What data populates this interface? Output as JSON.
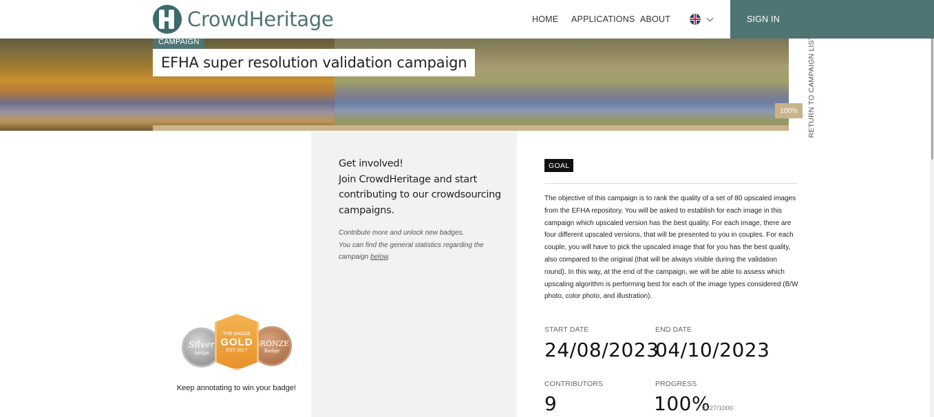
{
  "header": {
    "logo_text": "CrowdHeritage",
    "nav": {
      "home": "HOME",
      "applications": "APPLICATIONS",
      "about": "ABOUT"
    },
    "language_icon": "uk-flag-icon",
    "sign_in": "SIGN IN"
  },
  "hero": {
    "tag": "CAMPAIGN",
    "title": "EFHA super resolution validation campaign",
    "progress_percent": 100,
    "progress_label": "100%",
    "return_link": "RETURN TO CAMPAIGN LIST"
  },
  "badges": {
    "silver": {
      "label": "Silver",
      "sub": "badge"
    },
    "gold": {
      "label": "GOLD",
      "top": "THE BADGE",
      "sub": "EST 2017"
    },
    "bronze": {
      "label": "BRONZE",
      "sub": "Badge"
    },
    "caption": "Keep annotating to win your badge!"
  },
  "involve": {
    "line1": "Get involved!",
    "line2": "Join CrowdHeritage and start contributing to our crowdsourcing campaigns.",
    "note1": "Contribute more and unlock new badges.",
    "note2_prefix": "You can find the general statistics regarding the campaign ",
    "note2_link": "below",
    "note2_suffix": "."
  },
  "goal": {
    "tag": "GOAL",
    "description": "The objective of this campaign is to rank the quality of a set of 80 upscaled images from the EFHA repository. You will be asked to establish for each image in this campaign which upscaled version has the best quality. For each image, there are four different upscaled versions, that will be presented to you in couples. For each couple, you will have to pick the upscaled image that for you has the best quality, also compared to the original (that will be always visible during the validation round). In this way, at the end of the campaign, we will be able to assess which upscaling algorithm is performing best for each of the image types considered (B/W photo, color photo, and illustration)."
  },
  "stats": {
    "start_label": "START DATE",
    "start_value": "24/08/2023",
    "end_label": "END DATE",
    "end_value": "04/10/2023",
    "contributors_label": "CONTRIBUTORS",
    "contributors_value": "9",
    "progress_label": "PROGRESS",
    "progress_value": "100%",
    "progress_detail": "2127/1000"
  },
  "colors": {
    "brand": "#4f7474",
    "progress": "#c9b38a",
    "panel": "#f2f2f2"
  }
}
